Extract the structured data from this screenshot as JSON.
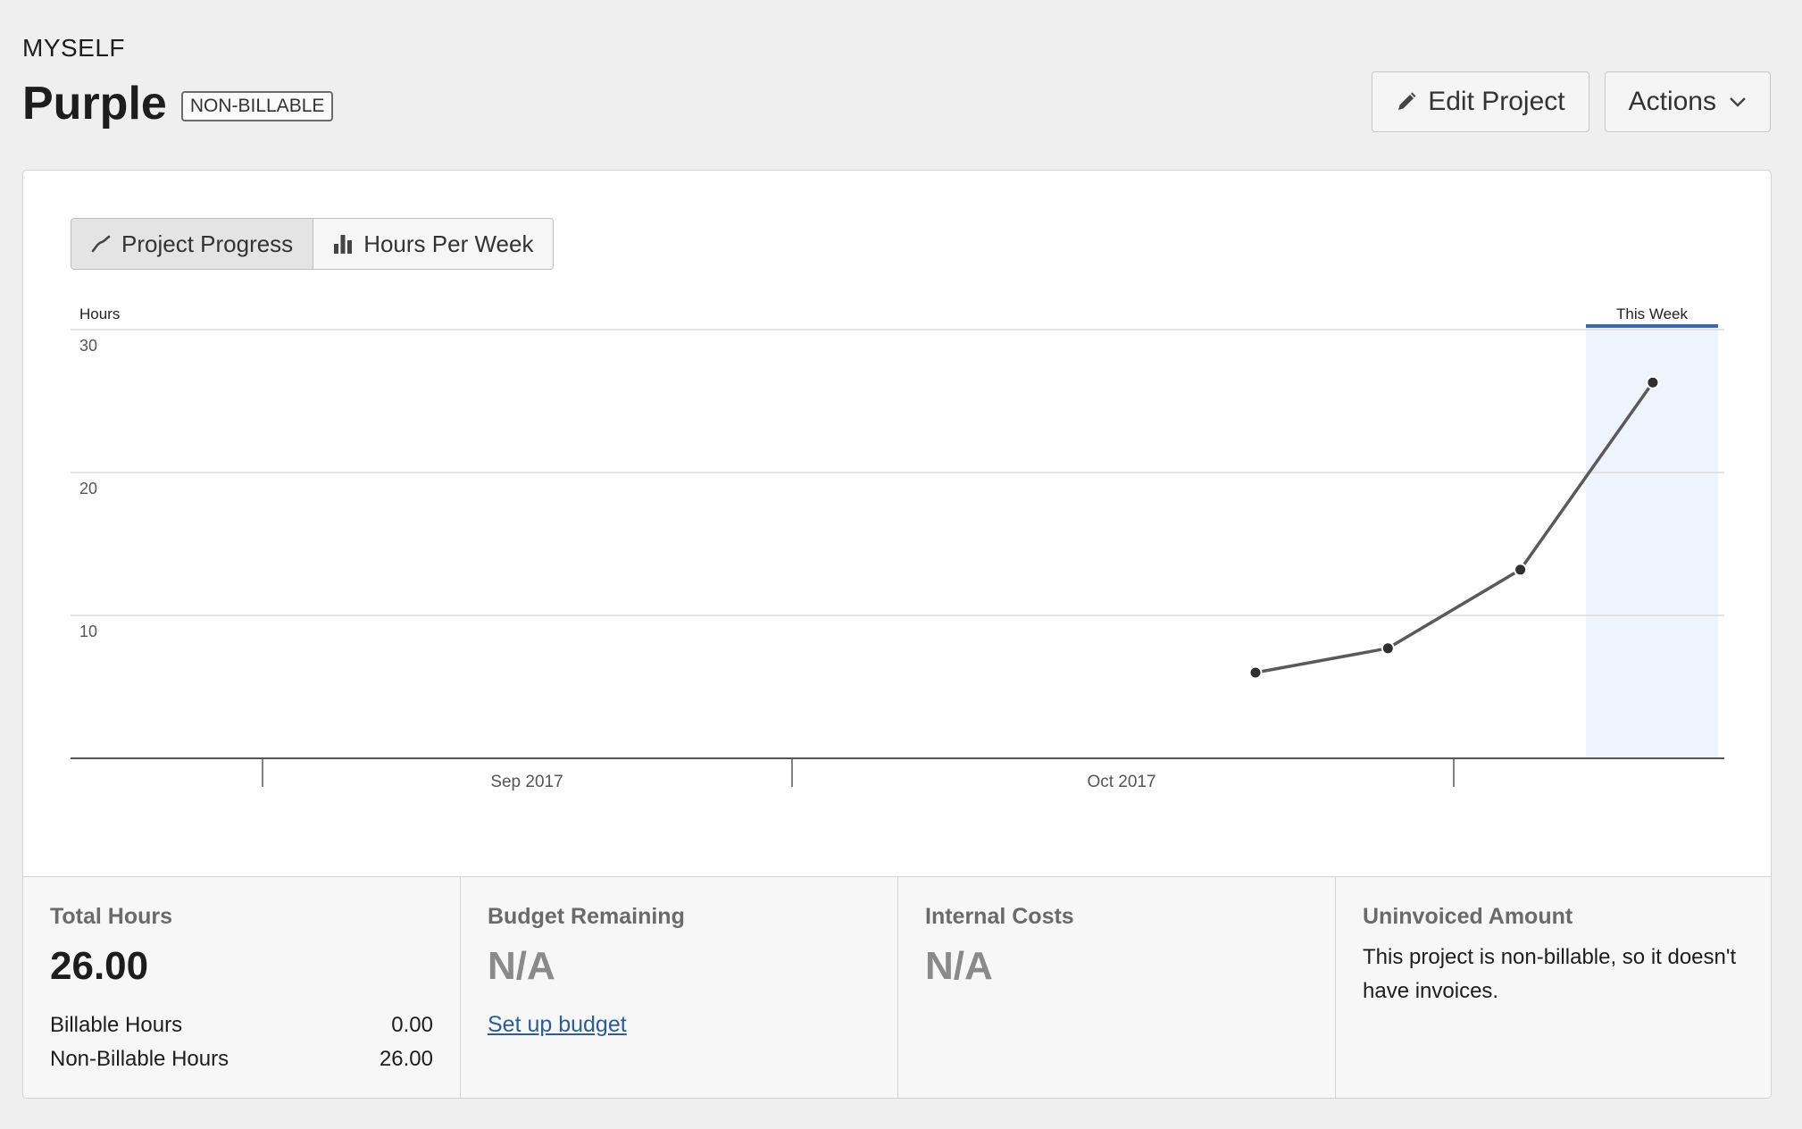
{
  "header": {
    "client": "MYSELF",
    "project_name": "Purple",
    "badge": "NON-BILLABLE",
    "edit_button": "Edit Project",
    "actions_button": "Actions"
  },
  "chart_tabs": {
    "progress": "Project Progress",
    "per_week": "Hours Per Week"
  },
  "chart_data": {
    "type": "line",
    "ylabel": "Hours",
    "y_ticks": [
      30,
      20,
      10
    ],
    "ylim": [
      0,
      30
    ],
    "x_labels": [
      "Sep 2017",
      "Oct 2017"
    ],
    "highlight_label": "This Week",
    "series": [
      {
        "values": [
          6,
          7.7,
          13.2,
          26.3
        ]
      }
    ],
    "grid": true,
    "colors": {
      "line": "#5a5a5a",
      "point": "#2f2f2f",
      "highlight": "#edf4fd",
      "highlight_bar": "#3a68b4"
    }
  },
  "stats": {
    "total_hours": {
      "label": "Total Hours",
      "value": "26.00",
      "billable_label": "Billable Hours",
      "billable_value": "0.00",
      "nonbillable_label": "Non-Billable Hours",
      "nonbillable_value": "26.00"
    },
    "budget": {
      "label": "Budget Remaining",
      "value": "N/A",
      "link": "Set up budget"
    },
    "internal_costs": {
      "label": "Internal Costs",
      "value": "N/A"
    },
    "uninvoiced": {
      "label": "Uninvoiced Amount",
      "text": "This project is non-billable, so it doesn't have invoices."
    }
  }
}
